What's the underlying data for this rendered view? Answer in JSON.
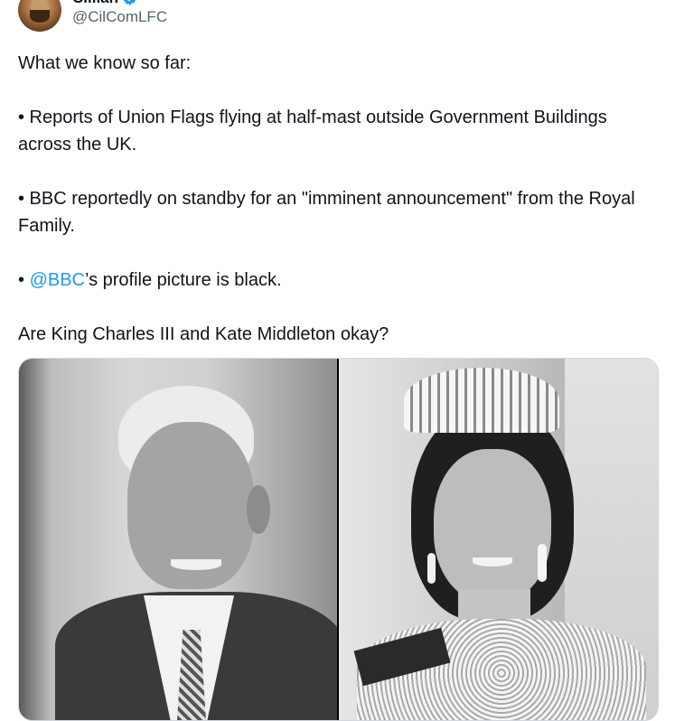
{
  "author": {
    "display_name": "Cillian",
    "handle": "@CilComLFC",
    "verified": true,
    "avatar_icon": "profile-avatar",
    "verified_icon": "verified-badge-icon",
    "verified_color": "#1d9bf0"
  },
  "tweet": {
    "paragraph_1": "What we know so far:",
    "paragraph_2": "• Reports of Union Flags flying at half-mast outside Government Buildings across the UK.",
    "paragraph_3": "• BBC reportedly on standby for an \"imminent announcement\" from the Royal Family.",
    "paragraph_4_prefix": "• ",
    "paragraph_4_mention": "@BBC",
    "paragraph_4_suffix": "’s profile picture is black.",
    "paragraph_5": "Are King Charles III and Kate Middleton okay?"
  },
  "media": {
    "count": 2,
    "style": "black-and-white photos",
    "mention_color": "#1d9bf0"
  }
}
